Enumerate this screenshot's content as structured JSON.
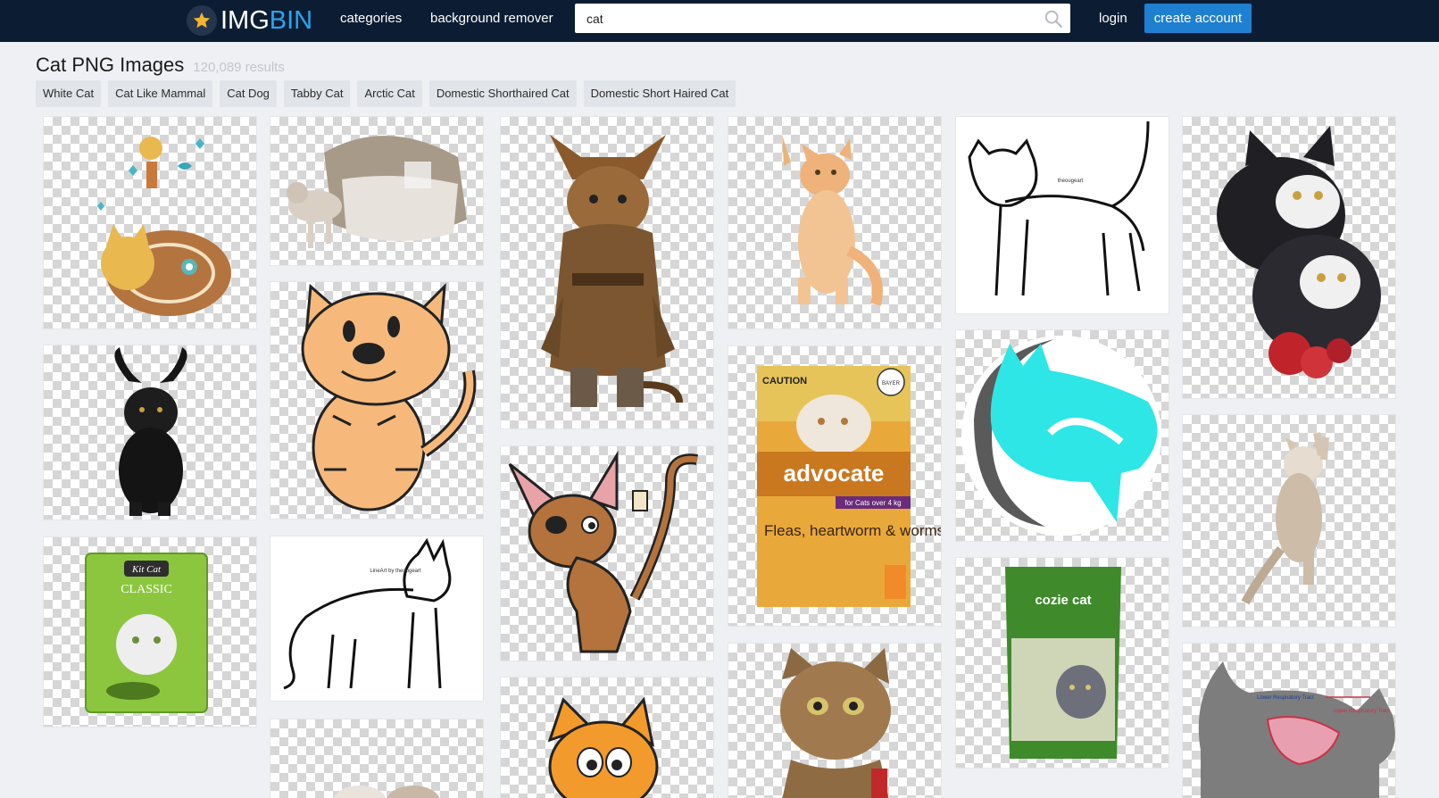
{
  "header": {
    "logo": {
      "part1": "IMG",
      "part2": "BIN"
    },
    "nav": {
      "categories": "categories",
      "background_remover": "background remover"
    },
    "search": {
      "value": "cat"
    },
    "login": "login",
    "create_account": "create account"
  },
  "page": {
    "title": "Cat PNG Images",
    "result_count": "120,089 results"
  },
  "tags": [
    "White Cat",
    "Cat Like Mammal",
    "Cat Dog",
    "Tabby Cat",
    "Arctic Cat",
    "Domestic Shorthaired Cat",
    "Domestic Short Haired Cat"
  ],
  "tile_text": {
    "advocate_caution": "CAUTION",
    "advocate_brand": "advocate",
    "advocate_dose": "for Cats over 4 kg",
    "advocate_claim": "Fleas, heartworm & worms",
    "advocate_bayer": "BAYER",
    "kitcat_brand": "Kit Cat",
    "kitcat_line": "CLASSIC",
    "cozie_brand": "cozie cat",
    "lineart_sig": "theougeart",
    "lineart_sig2": "LineArt by theougeart",
    "anatomy_lower": "Lower Respiratory Tract",
    "anatomy_upper": "Upper Respiratory Tract"
  },
  "colors": {
    "header_bg": "#0c1d33",
    "accent": "#1f7fd1",
    "logo_blue": "#2aa5f0",
    "logo_star": "#f3b431"
  }
}
